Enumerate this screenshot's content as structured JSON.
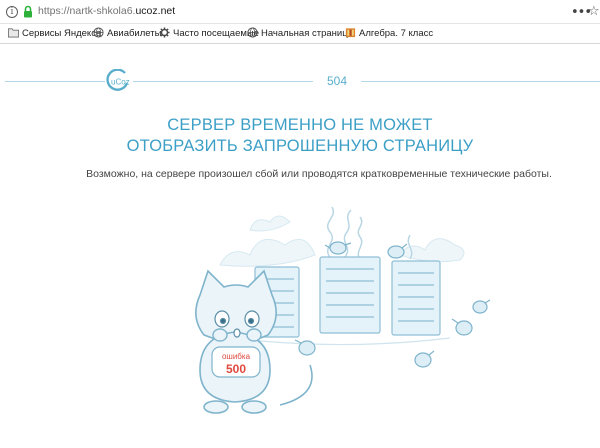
{
  "browser": {
    "info_icon": "info-icon",
    "lock_icon": "lock-icon",
    "url_prefix": "https://nartk-shkola6.",
    "url_domain": "ucoz.net",
    "menu_glyph": "•••",
    "bookmark_star_glyph": "☆"
  },
  "bookmarks": [
    {
      "label": "Сервисы Яндекса",
      "icon": "folder-icon"
    },
    {
      "label": "Авиабилеты",
      "icon": "globe-icon"
    },
    {
      "label": "Часто посещаемые",
      "icon": "gear-icon"
    },
    {
      "label": "Начальная страница",
      "icon": "globe-icon"
    },
    {
      "label": "Алгебра. 7 класс",
      "icon": "book-icon"
    }
  ],
  "header": {
    "logo_text": "uCoz",
    "code": "504"
  },
  "error": {
    "title_line1": "СЕРВЕР ВРЕМЕННО НЕ МОЖЕТ",
    "title_line2": "ОТОБРАЗИТЬ ЗАПРОШЕННУЮ СТРАНИЦУ",
    "message": "Возможно, на сервере произошел сбой или проводятся кратковременные технические работы."
  },
  "illustration": {
    "shirt_text": "ошибка",
    "shirt_code": "500"
  },
  "colors": {
    "accent": "#3c9fc6",
    "line": "#b6d8e6",
    "illustration_stroke": "#8fbfd6",
    "illustration_fill": "#e4f2f9",
    "shirt_text": "#e0493d"
  }
}
